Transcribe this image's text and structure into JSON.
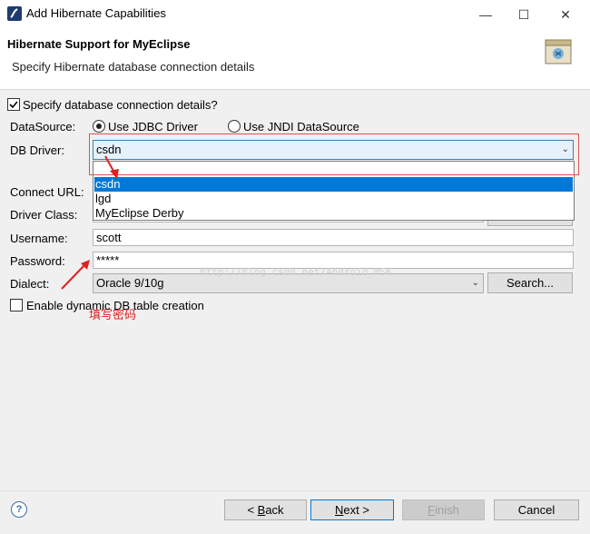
{
  "window": {
    "title": "Add Hibernate Capabilities",
    "minimize": "—",
    "maximize": "☐",
    "close": "✕"
  },
  "header": {
    "title": "Hibernate Support for MyEclipse",
    "subtitle": "Specify Hibernate database connection details"
  },
  "form": {
    "specify_checkbox_label": "Specify database connection details?",
    "specify_checked": true,
    "datasource_label": "DataSource:",
    "radio_jdbc": "Use JDBC Driver",
    "radio_jndi": "Use JNDI DataSource",
    "radio_selected": "jdbc",
    "db_driver_label": "DB Driver:",
    "db_driver_value": "csdn",
    "db_driver_options": [
      "",
      "csdn",
      "lgd",
      "MyEclipse Derby"
    ],
    "db_driver_highlighted": "csdn",
    "connect_url_label": "Connect URL:",
    "driver_class_label": "Driver Class:",
    "username_label": "Username:",
    "username_value": "scott",
    "password_label": "Password:",
    "password_value": "*****",
    "dialect_label": "Dialect:",
    "dialect_value": "Oracle 9/10g",
    "search_button": "Search...",
    "dynamic_label": "Enable dynamic DB table creation",
    "dynamic_checked": false
  },
  "annotations": {
    "watermark": "http://blog.csdn.net/Android_MSK",
    "note": "填写密码",
    "accent_color": "#e02020"
  },
  "footer": {
    "help_icon": "?",
    "back_prefix": "< ",
    "back_mnemonic": "B",
    "back_rest": "ack",
    "next_mnemonic": "N",
    "next_rest": "ext >",
    "finish_mnemonic": "F",
    "finish_rest": "inish",
    "cancel": "Cancel"
  },
  "colors": {
    "selection": "#0078d7",
    "header_bg": "#ffffff",
    "body_bg": "#f0f0f0"
  }
}
